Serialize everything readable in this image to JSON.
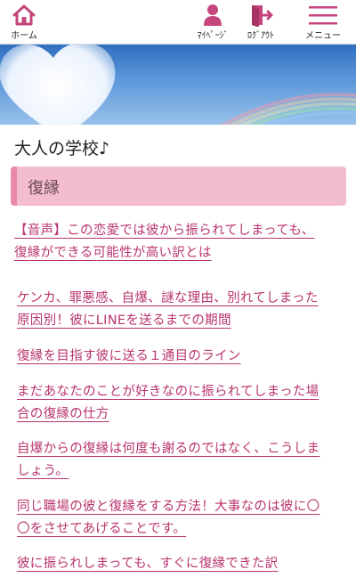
{
  "header": {
    "home_label": "ホーム",
    "mypage_label": "ﾏｲﾍﾟｰｼﾞ",
    "logout_label": "ﾛｸﾞｱｳﾄ",
    "menu_label": "メニュー",
    "icons": [
      "home-icon",
      "person-icon",
      "logout-icon",
      "hamburger-icon"
    ]
  },
  "site_title": "大人の学校♪",
  "category": {
    "label": "復縁",
    "color": "#f4bccf",
    "accent": "#e889ab"
  },
  "link_color": "#b9356e",
  "articles": [
    {
      "line1": "【音声】この恋愛では彼から振られてしまっても、",
      "line2": "復縁ができる可能性が高い訳とは"
    },
    {
      "line1": "ケンカ、罪悪感、自爆、謎な理由、別れてしまった",
      "line2": "原因別！彼にLINEを送るまでの期間"
    },
    {
      "line1": "復縁を目指す彼に送る１通目のライン",
      "line2": ""
    },
    {
      "line1": "まだあなたのことが好きなのに振られてしまった場",
      "line2": "合の復縁の仕方"
    },
    {
      "line1": "自爆からの復縁は何度も謝るのではなく、こうしま",
      "line2": "しょう。"
    },
    {
      "line1": "同じ職場の彼と復縁をする方法！大事なのは彼に〇",
      "line2": "〇をさせてあげることです。"
    },
    {
      "line1": "彼に振られしまっても、すぐに復縁できた訳",
      "line2": ""
    }
  ]
}
